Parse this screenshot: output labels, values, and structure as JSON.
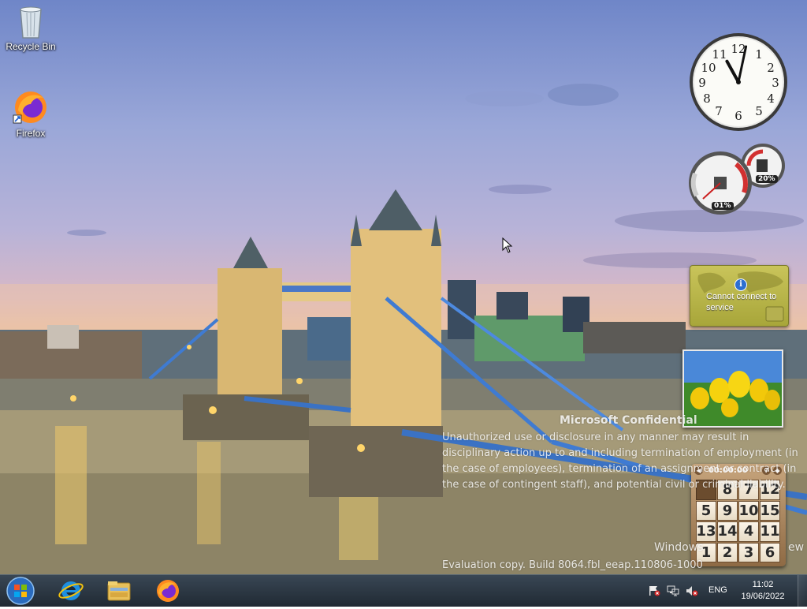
{
  "desktop": {
    "icons": [
      {
        "label": "Recycle Bin",
        "icon": "recycle-bin-icon"
      },
      {
        "label": "Firefox",
        "icon": "firefox-icon"
      }
    ]
  },
  "gadgets": {
    "clock": {
      "hour": 11,
      "minute": 2
    },
    "cpu_meter": {
      "cpu": "01%",
      "memory": "20%"
    },
    "weather": {
      "message": "Cannot connect to service"
    },
    "puzzle": {
      "timer": "00:00:00",
      "tiles": [
        "",
        "8",
        "7",
        "12",
        "5",
        "9",
        "10",
        "15",
        "13",
        "14",
        "4",
        "11",
        "1",
        "2",
        "3",
        "6"
      ]
    }
  },
  "watermark": {
    "title": "Microsoft Confidential",
    "body": "Unauthorized use or disclosure in any manner may result in disciplinary action up to and including termination of employment (in the case of employees), termination of an assignment or contract (in the case of contingent staff), and potential civil or criminal liability.",
    "windows": "Windows",
    "preview": "ew",
    "evaluation": "Evaluation copy. Build 8064.fbl_eeap.110806-1000"
  },
  "taskbar": {
    "pinned": [
      "internet-explorer-icon",
      "windows-explorer-icon",
      "firefox-icon"
    ],
    "language": "ENG",
    "time": "11:02",
    "date": "19/06/2022"
  },
  "colors": {
    "weather_bg": "#b8b548",
    "puzzle_bg": "#a98258",
    "taskbar": "#1c2a36"
  }
}
